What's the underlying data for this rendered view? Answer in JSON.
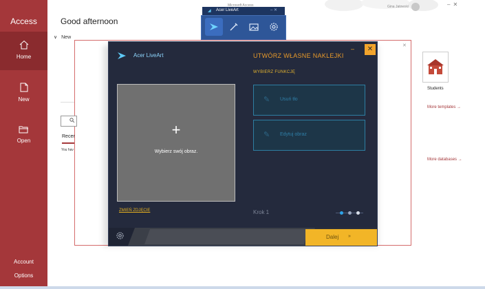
{
  "access": {
    "app_name": "Access",
    "window_title": "Microsoft Access",
    "user_name": "Gina Jatowski",
    "greeting": "Good afternoon",
    "new_section": "New",
    "sidebar": {
      "home": "Home",
      "new": "New",
      "open": "Open",
      "account": "Account",
      "options": "Options"
    },
    "templates": {
      "students": "Students",
      "more_templates": "More templates",
      "more_databases": "More databases"
    },
    "recent_tab": "Recer",
    "recent_message": "You hav"
  },
  "liveart_mini": {
    "title": "Acer LiveArt"
  },
  "liveart_dialog": {
    "title": "Acer LiveArt",
    "panel_title": "UTWÓRZ WŁASNE NAKLEJKI",
    "choose_function": "WYBIERZ FUNKCJĘ",
    "drop_plus": "+",
    "drop_text": "Wybierz swój obraz.",
    "remove_background": "Usuń tło",
    "edit_image": "Edytuj obraz",
    "change_photo": "ZMIEŃ ZDJĘCIE",
    "step": "Krok 1",
    "next": "Dalej",
    "colors": {
      "accent": "#f2b527",
      "panel_title": "#e89a2a",
      "background": "#242a3d",
      "cyan": "#2ea3e8"
    }
  },
  "icons": [
    "home-icon",
    "new-file-icon",
    "open-folder-icon",
    "liveart-logo-icon",
    "brush-icon",
    "gallery-icon",
    "settings-icon",
    "gear-icon",
    "close-icon",
    "minimize-icon"
  ]
}
